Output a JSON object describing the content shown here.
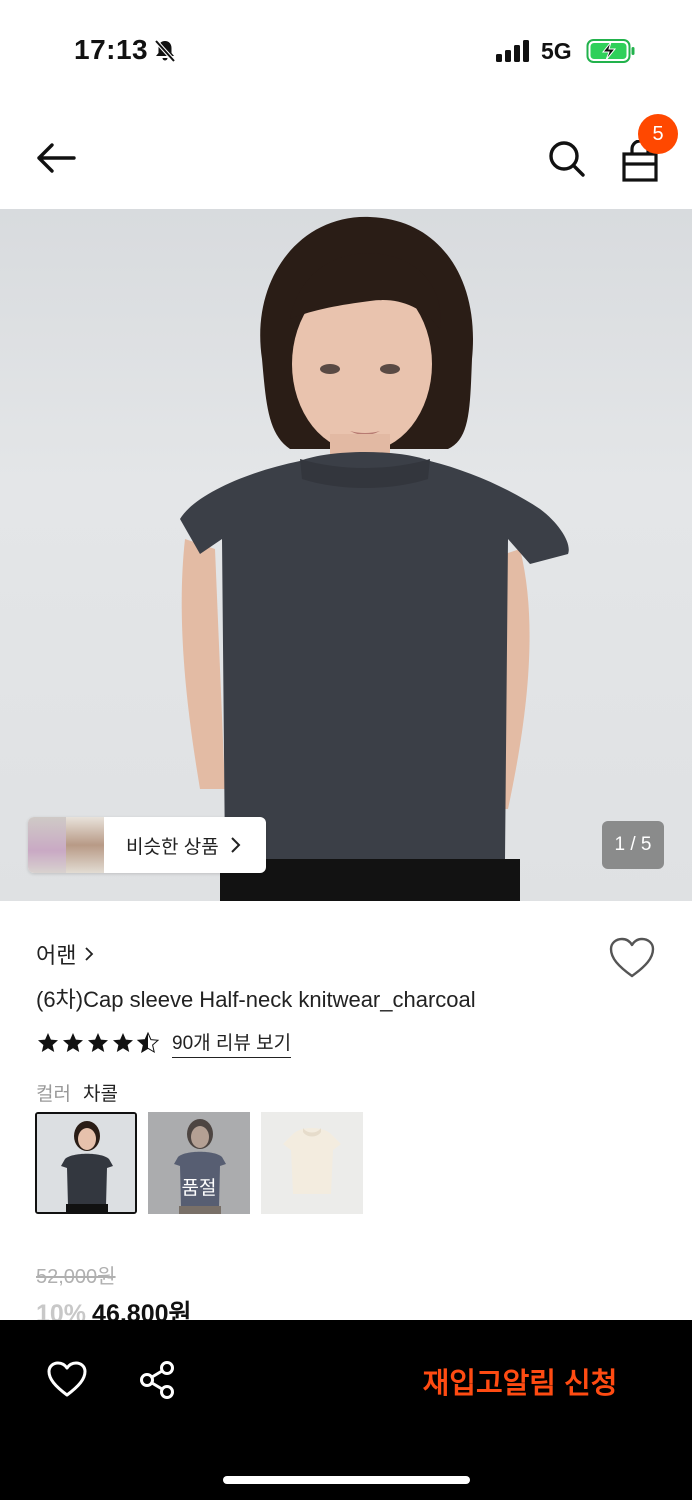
{
  "status_bar": {
    "time": "17:13",
    "network": "5G",
    "icons": [
      "bell-slash-icon",
      "signal-icon",
      "battery-charging-icon"
    ]
  },
  "header": {
    "icons": [
      "back-arrow-icon",
      "search-icon",
      "shopping-bag-icon"
    ],
    "cart_count": "5"
  },
  "gallery": {
    "similar_label": "비슷한 상품",
    "page_indicator": "1 / 5"
  },
  "product": {
    "brand": "어랜",
    "title": "(6차)Cap sleeve Half-neck knitwear_charcoal",
    "rating": 4.5,
    "review_link": "90개 리뷰 보기",
    "color_label": "컬러",
    "color_value": "차콜",
    "swatches": [
      {
        "color": "charcoal",
        "selected": true,
        "soldout": false
      },
      {
        "color": "navy",
        "selected": false,
        "soldout": true,
        "soldout_label": "품절"
      },
      {
        "color": "ivory",
        "selected": false,
        "soldout": false
      }
    ],
    "original_price": "52,000원",
    "discount": "10%",
    "price": "46,800원"
  },
  "bottom_bar": {
    "restock_label": "재입고알림 신청",
    "icons": [
      "heart-icon",
      "share-icon"
    ]
  },
  "colors": {
    "accent": "#ff4800",
    "restock_text": "#ff4b12",
    "bottom_bar_bg": "#000000"
  }
}
